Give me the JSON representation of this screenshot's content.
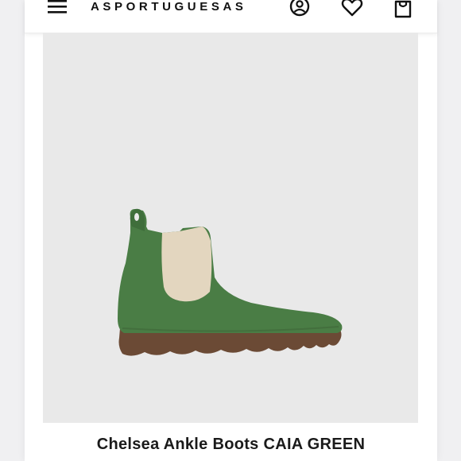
{
  "header": {
    "logo_text": "ASPORTUGUESAS",
    "menu_icon": "hamburger-menu-icon",
    "account_icon": "account-icon",
    "wishlist_icon": "heart-icon",
    "cart_icon": "shopping-bag-icon"
  },
  "product": {
    "title": "Chelsea Ankle Boots CAIA GREEN",
    "image_subject": "green felt chelsea ankle boot with beige elastic panel and brown rubber sole",
    "colors": {
      "boot": "#4a7d45",
      "elastic": "#e3d6bf",
      "sole": "#6b4a35",
      "background": "#e9e9e9"
    }
  }
}
